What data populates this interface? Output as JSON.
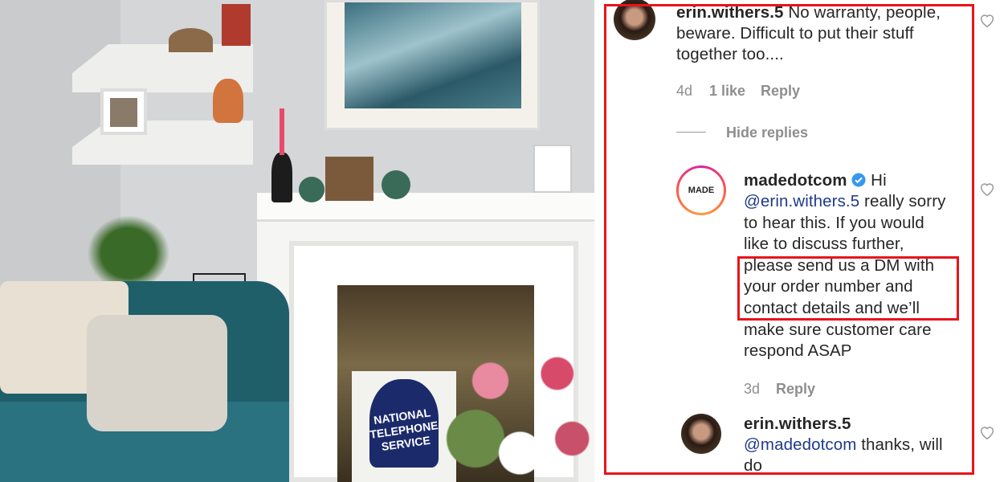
{
  "photo": {
    "sign_text": [
      "NATIONAL",
      "TELEPHONE",
      "SERVICE"
    ]
  },
  "comments": [
    {
      "username": "erin.withers.5",
      "lines": [
        "No warranty, people,",
        "beware. Difficult to put their stuff",
        "together too...."
      ],
      "time": "4d",
      "likes": "1 like",
      "reply": "Reply"
    },
    {
      "username": "madedotcom",
      "verified": true,
      "avatar_text": "MADE",
      "lines": [
        "Hi",
        "@erin.withers.5",
        "really sorry",
        "to hear this. If you would",
        "like to discuss further,",
        "please send us a DM with",
        "your order number and",
        "contact details and we’ll",
        "make sure customer care",
        "respond ASAP"
      ],
      "time": "3d",
      "reply": "Reply"
    },
    {
      "username": "erin.withers.5",
      "lines": [
        "@madedotcom",
        "thanks, will",
        "do"
      ]
    }
  ],
  "hide_replies": "Hide replies",
  "colors": {
    "highlight": "#e8141a",
    "mention": "#1e3a8a",
    "meta": "#8e8e8e",
    "verified": "#3897f0"
  }
}
